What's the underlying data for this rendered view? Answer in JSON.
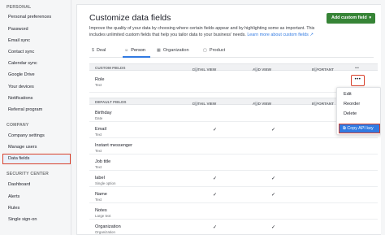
{
  "sidebar": {
    "sections": {
      "personal": "PERSONAL",
      "company": "COMPANY",
      "security": "SECURITY CENTER"
    },
    "personal_items": [
      "Personal preferences",
      "Password",
      "Email sync",
      "Contact sync",
      "Calendar sync",
      "Google Drive",
      "Your devices",
      "Notifications",
      "Referral program"
    ],
    "company_items": [
      "Company settings",
      "Manage users",
      "Data fields"
    ],
    "security_items": [
      "Dashboard",
      "Alerts",
      "Rules",
      "Single sign-on"
    ],
    "active_item": "Data fields"
  },
  "header": {
    "title": "Customize data fields",
    "description": "Improve the quality of your data by choosing where certain fields appear and by highlighting some as important. This includes unlimited custom fields that help you tailor data to your business' needs.",
    "learn_more": "Learn more about custom fields",
    "add_button": "Add custom field",
    "add_button_caret": "▾"
  },
  "tabs": [
    {
      "label": "Deal",
      "icon": "$"
    },
    {
      "label": "Person",
      "icon": "☺"
    },
    {
      "label": "Organization",
      "icon": "▦"
    },
    {
      "label": "Product",
      "icon": "▢"
    }
  ],
  "active_tab": "Person",
  "columns": {
    "custom": "CUSTOM FIELDS",
    "default": "DEFAULT FIELDS",
    "detail_view": "DETAIL VIEW",
    "add_view": "ADD VIEW",
    "important": "IMPORTANT",
    "help_icon": "?",
    "more": "•••"
  },
  "custom_fields": [
    {
      "name": "Role",
      "type": "Text",
      "detail": false,
      "add": false
    }
  ],
  "default_fields": [
    {
      "name": "Birthday",
      "type": "Date",
      "detail": false,
      "add": false
    },
    {
      "name": "Email",
      "type": "Text",
      "detail": true,
      "add": true
    },
    {
      "name": "Instant messenger",
      "type": "Text",
      "detail": false,
      "add": false
    },
    {
      "name": "Job title",
      "type": "Text",
      "detail": false,
      "add": false
    },
    {
      "name": "label",
      "type": "Single option",
      "detail": true,
      "add": true
    },
    {
      "name": "Name",
      "type": "Text",
      "detail": true,
      "add": true
    },
    {
      "name": "Notes",
      "type": "Large text",
      "detail": false,
      "add": false
    },
    {
      "name": "Organization",
      "type": "Organization",
      "detail": true,
      "add": true
    }
  ],
  "check_glyph": "✓",
  "context_menu": {
    "items": [
      "Edit",
      "Reorder",
      "Delete"
    ],
    "copy_api_key": "Copy API key",
    "copy_icon": "⧉"
  }
}
